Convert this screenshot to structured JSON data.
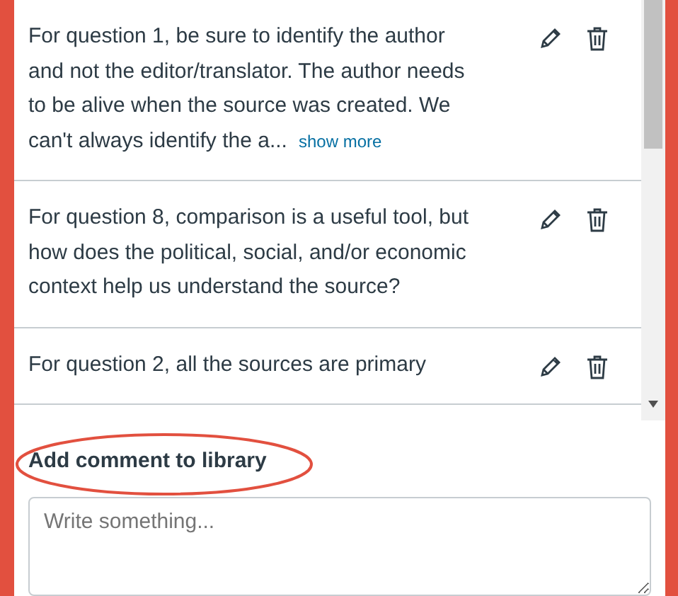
{
  "comments": [
    {
      "text": "For question 1, be sure to identify the author and not the editor/translator. The author needs to be alive when the source was created. We can't always identify the a...",
      "link": "show more"
    },
    {
      "text": "For question 8, comparison is a useful tool, but how does the political, social, and/or economic context help us understand the source?"
    },
    {
      "text": "For question 2, all the sources are primary"
    }
  ],
  "add_comment": {
    "title": "Add comment to library",
    "circled": true,
    "placeholder": "Write something..."
  }
}
